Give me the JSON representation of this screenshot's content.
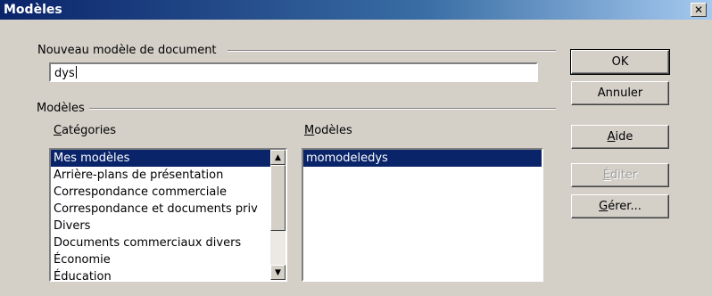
{
  "window": {
    "title": "Modèles"
  },
  "close_icon": "close-icon",
  "new_doc": {
    "label": "Nouveau modèle de document",
    "value": "dys"
  },
  "models_group": {
    "label": "Modèles"
  },
  "categories": {
    "label_first": "C",
    "label_rest": "atégories",
    "items": [
      "Mes modèles",
      "Arrière-plans de présentation",
      "Correspondance commerciale",
      "Correspondance et documents priv",
      "Divers",
      "Documents commerciaux divers",
      "Économie",
      "Éducation"
    ],
    "selected_index": 0
  },
  "models": {
    "label_first": "M",
    "label_rest": "odèles",
    "items": [
      "momodeledys"
    ],
    "selected_index": 0
  },
  "buttons": {
    "ok": "OK",
    "cancel": "Annuler",
    "help_first": "A",
    "help_rest": "ide",
    "edit_first": "É",
    "edit_rest": "diter",
    "manage_first": "G",
    "manage_rest": "érer..."
  },
  "colors": {
    "titlebar_start": "#0a246a",
    "selection": "#0a246a",
    "face": "#d4d0c8"
  }
}
